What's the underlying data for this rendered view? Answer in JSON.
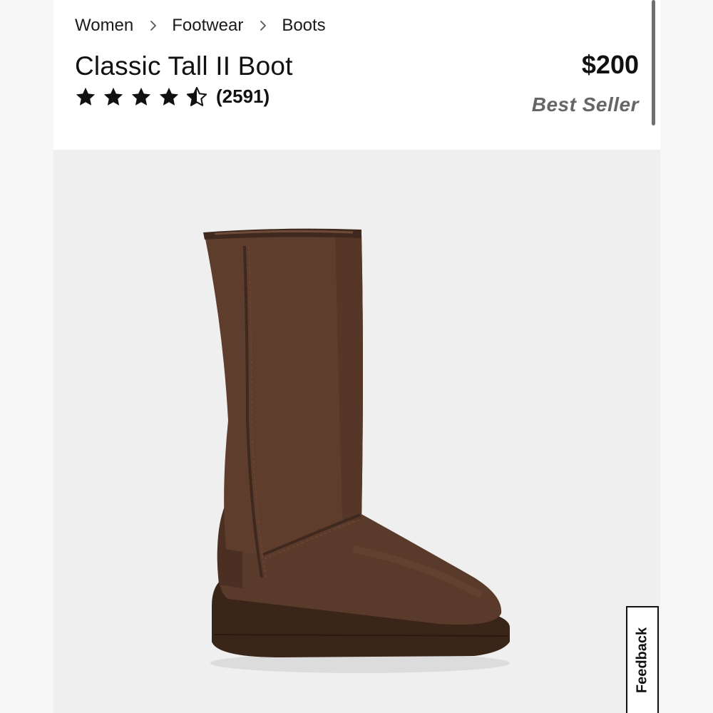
{
  "breadcrumb": {
    "items": [
      "Women",
      "Footwear",
      "Boots"
    ]
  },
  "product": {
    "title": "Classic Tall II Boot",
    "price": "$200",
    "badge": "Best Seller",
    "rating": {
      "stars": 4.5,
      "max": 5,
      "count_label": "(2591)"
    }
  },
  "feedback": {
    "label": "Feedback"
  },
  "colors": {
    "boot": "#5a3a2b",
    "boot_dark": "#3f281d",
    "image_bg": "#efefef",
    "badge_text": "#666666"
  },
  "icons": {
    "breadcrumb_separator": "chevron-right-icon",
    "star_full": "star-filled-icon",
    "star_half": "star-half-icon"
  }
}
